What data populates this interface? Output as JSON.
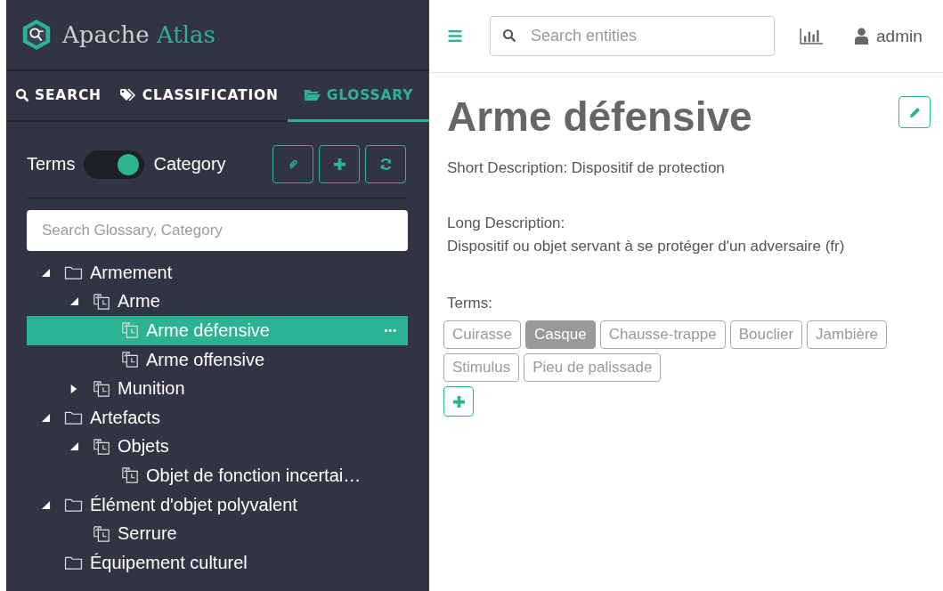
{
  "logo": {
    "word_1": "Apache",
    "word_2": "Atlas"
  },
  "nav_tabs": [
    {
      "label": "SEARCH",
      "kind": "search",
      "selected": false
    },
    {
      "label": "CLASSIFICATION",
      "kind": "tag",
      "selected": false
    },
    {
      "label": "GLOSSARY",
      "kind": "folder",
      "selected": true
    }
  ],
  "view_toggle": {
    "left_label": "Terms",
    "right_label": "Category",
    "on": true
  },
  "glossary_search": {
    "placeholder": "Search Glossary, Category"
  },
  "tree": [
    {
      "label": "Armement",
      "kind": "folder",
      "expanded": true,
      "selected": false,
      "children": [
        {
          "label": "Arme",
          "kind": "category",
          "expanded": true,
          "selected": false,
          "children": [
            {
              "label": "Arme défensive",
              "kind": "category",
              "selected": true,
              "more": "•••"
            },
            {
              "label": "Arme offensive",
              "kind": "category",
              "selected": false
            }
          ]
        },
        {
          "label": "Munition",
          "kind": "category",
          "expanded": false,
          "selected": false
        }
      ]
    },
    {
      "label": "Artefacts",
      "kind": "folder",
      "expanded": true,
      "selected": false,
      "children": [
        {
          "label": "Objets",
          "kind": "category",
          "expanded": true,
          "selected": false,
          "children": [
            {
              "label": "Objet de fonction incertai…",
              "kind": "category",
              "selected": false
            }
          ]
        }
      ]
    },
    {
      "label": "Élément d'objet polyvalent",
      "kind": "folder",
      "expanded": true,
      "selected": false,
      "children": [
        {
          "label": "Serrure",
          "kind": "category",
          "selected": false
        }
      ]
    },
    {
      "label": "Équipement culturel",
      "kind": "folder",
      "selected": false
    }
  ],
  "top_search": {
    "placeholder": "Search entities"
  },
  "user": {
    "name": "admin"
  },
  "detail": {
    "title": "Arme défensive",
    "short_description": "Short Description: Dispositif de protection",
    "long_description_label": "Long Description:",
    "long_description": "Dispositif ou objet servant à se protéger d'un adversaire (fr)",
    "terms_label": "Terms:",
    "terms": [
      {
        "label": "Cuirasse",
        "selected": false
      },
      {
        "label": "Casque",
        "selected": true
      },
      {
        "label": "Chausse-trappe",
        "selected": false
      },
      {
        "label": "Bouclier",
        "selected": false
      },
      {
        "label": "Jambière",
        "selected": false
      },
      {
        "label": "Stimulus",
        "selected": false
      },
      {
        "label": "Pieu de palissade",
        "selected": false
      }
    ]
  }
}
